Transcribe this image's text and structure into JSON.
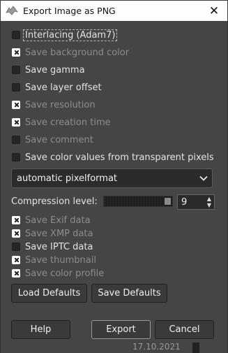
{
  "window": {
    "title": "Export Image as PNG",
    "close_symbol": "✕"
  },
  "options": [
    {
      "label": "Interlacing (Adam7)",
      "checked": false,
      "enabled": true
    },
    {
      "label": "Save background color",
      "checked": true,
      "enabled": false
    },
    {
      "label": "Save gamma",
      "checked": false,
      "enabled": true
    },
    {
      "label": "Save layer offset",
      "checked": false,
      "enabled": true
    },
    {
      "label": "Save resolution",
      "checked": true,
      "enabled": false
    },
    {
      "label": "Save creation time",
      "checked": true,
      "enabled": false
    },
    {
      "label": "Save comment",
      "checked": false,
      "enabled": false
    },
    {
      "label": "Save color values from transparent pixels",
      "checked": false,
      "enabled": true
    }
  ],
  "pixelformat": {
    "selected": "automatic pixelformat"
  },
  "compression": {
    "label": "Compression level:",
    "value": "9",
    "level_fraction": 1.0
  },
  "metadata": [
    {
      "label": "Save Exif data",
      "checked": true,
      "enabled": false
    },
    {
      "label": "Save XMP data",
      "checked": true,
      "enabled": false
    },
    {
      "label": "Save IPTC data",
      "checked": false,
      "enabled": true
    },
    {
      "label": "Save thumbnail",
      "checked": true,
      "enabled": false
    },
    {
      "label": "Save color profile",
      "checked": true,
      "enabled": false
    }
  ],
  "defaults_buttons": {
    "load": "Load Defaults",
    "save": "Save Defaults"
  },
  "footer_buttons": {
    "help": "Help",
    "export": "Export",
    "cancel": "Cancel"
  },
  "background_text": "17.10.2021"
}
